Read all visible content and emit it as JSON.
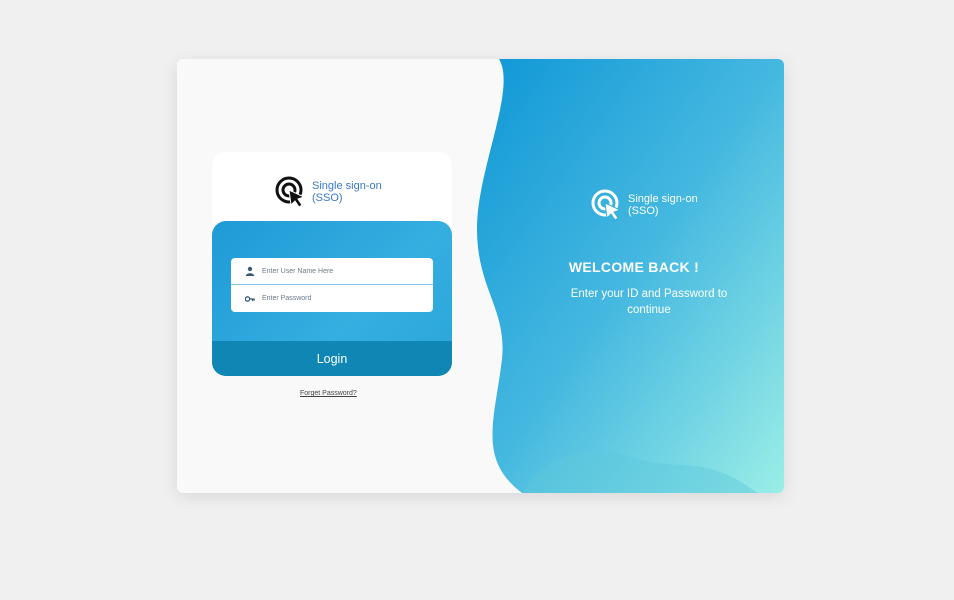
{
  "brand": {
    "name": "Single sign-on (SSO)",
    "icon": "cursor-target-icon"
  },
  "login": {
    "username_placeholder": "Enter User Name Here",
    "password_placeholder": "Enter Password",
    "username_value": "",
    "password_value": "",
    "user_icon": "user-icon",
    "key_icon": "key-icon",
    "login_label": "Login",
    "forgot_label": "Forget Password?"
  },
  "welcome": {
    "title": "WELCOME BACK !",
    "subtitle": "Enter your ID and Password to continue"
  },
  "colors": {
    "accent": "#1e9ad6",
    "button": "#0f86b4",
    "brand_text": "#3a78c9",
    "gradient_end": "#9beee6"
  }
}
